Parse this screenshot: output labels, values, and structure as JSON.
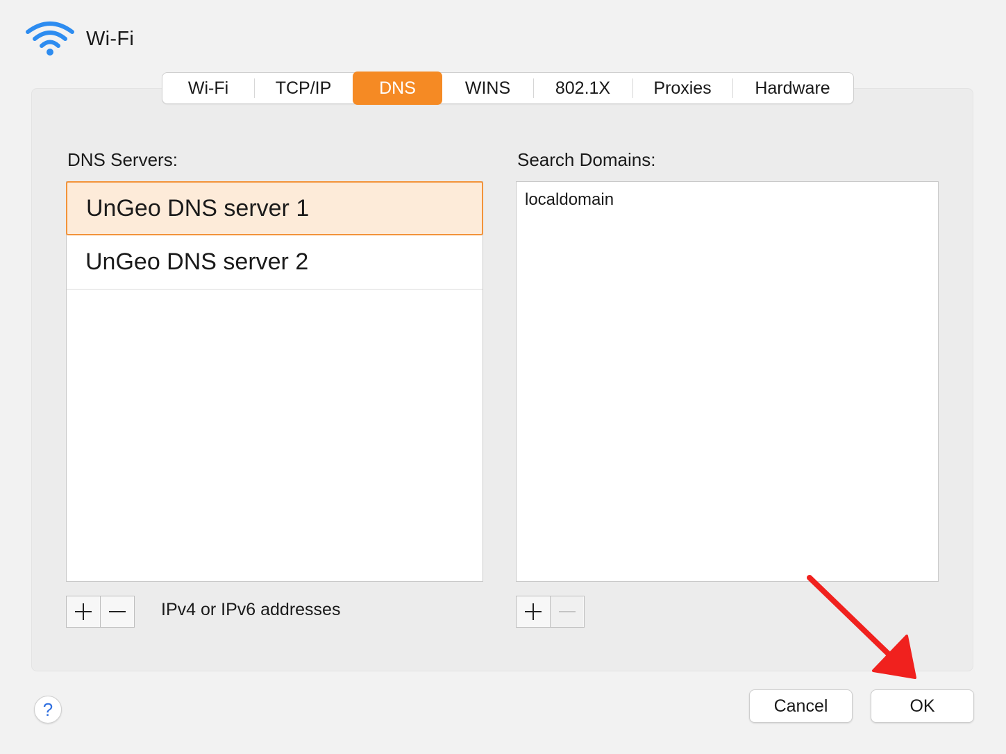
{
  "window": {
    "title": "Wi-Fi",
    "icon": "wifi-icon",
    "accent_color": "#f58a24",
    "icon_color": "#2d8cf0"
  },
  "tabs": [
    {
      "label": "Wi-Fi",
      "active": false
    },
    {
      "label": "TCP/IP",
      "active": false
    },
    {
      "label": "DNS",
      "active": true
    },
    {
      "label": "WINS",
      "active": false
    },
    {
      "label": "802.1X",
      "active": false
    },
    {
      "label": "Proxies",
      "active": false
    },
    {
      "label": "Hardware",
      "active": false
    }
  ],
  "dns_servers": {
    "label": "DNS Servers:",
    "items": [
      {
        "value": "UnGeo DNS server 1",
        "selected": true
      },
      {
        "value": "UnGeo DNS server 2",
        "selected": false
      }
    ],
    "add_icon": "plus-icon",
    "remove_icon": "minus-icon",
    "hint": "IPv4 or IPv6 addresses"
  },
  "search_domains": {
    "label": "Search Domains:",
    "items": [
      {
        "value": "localdomain"
      }
    ],
    "add_icon": "plus-icon",
    "remove_icon": "minus-icon"
  },
  "footer": {
    "help_label": "?",
    "cancel_label": "Cancel",
    "ok_label": "OK"
  },
  "annotation": {
    "type": "arrow",
    "color": "#f0211e",
    "target": "ok-button"
  }
}
